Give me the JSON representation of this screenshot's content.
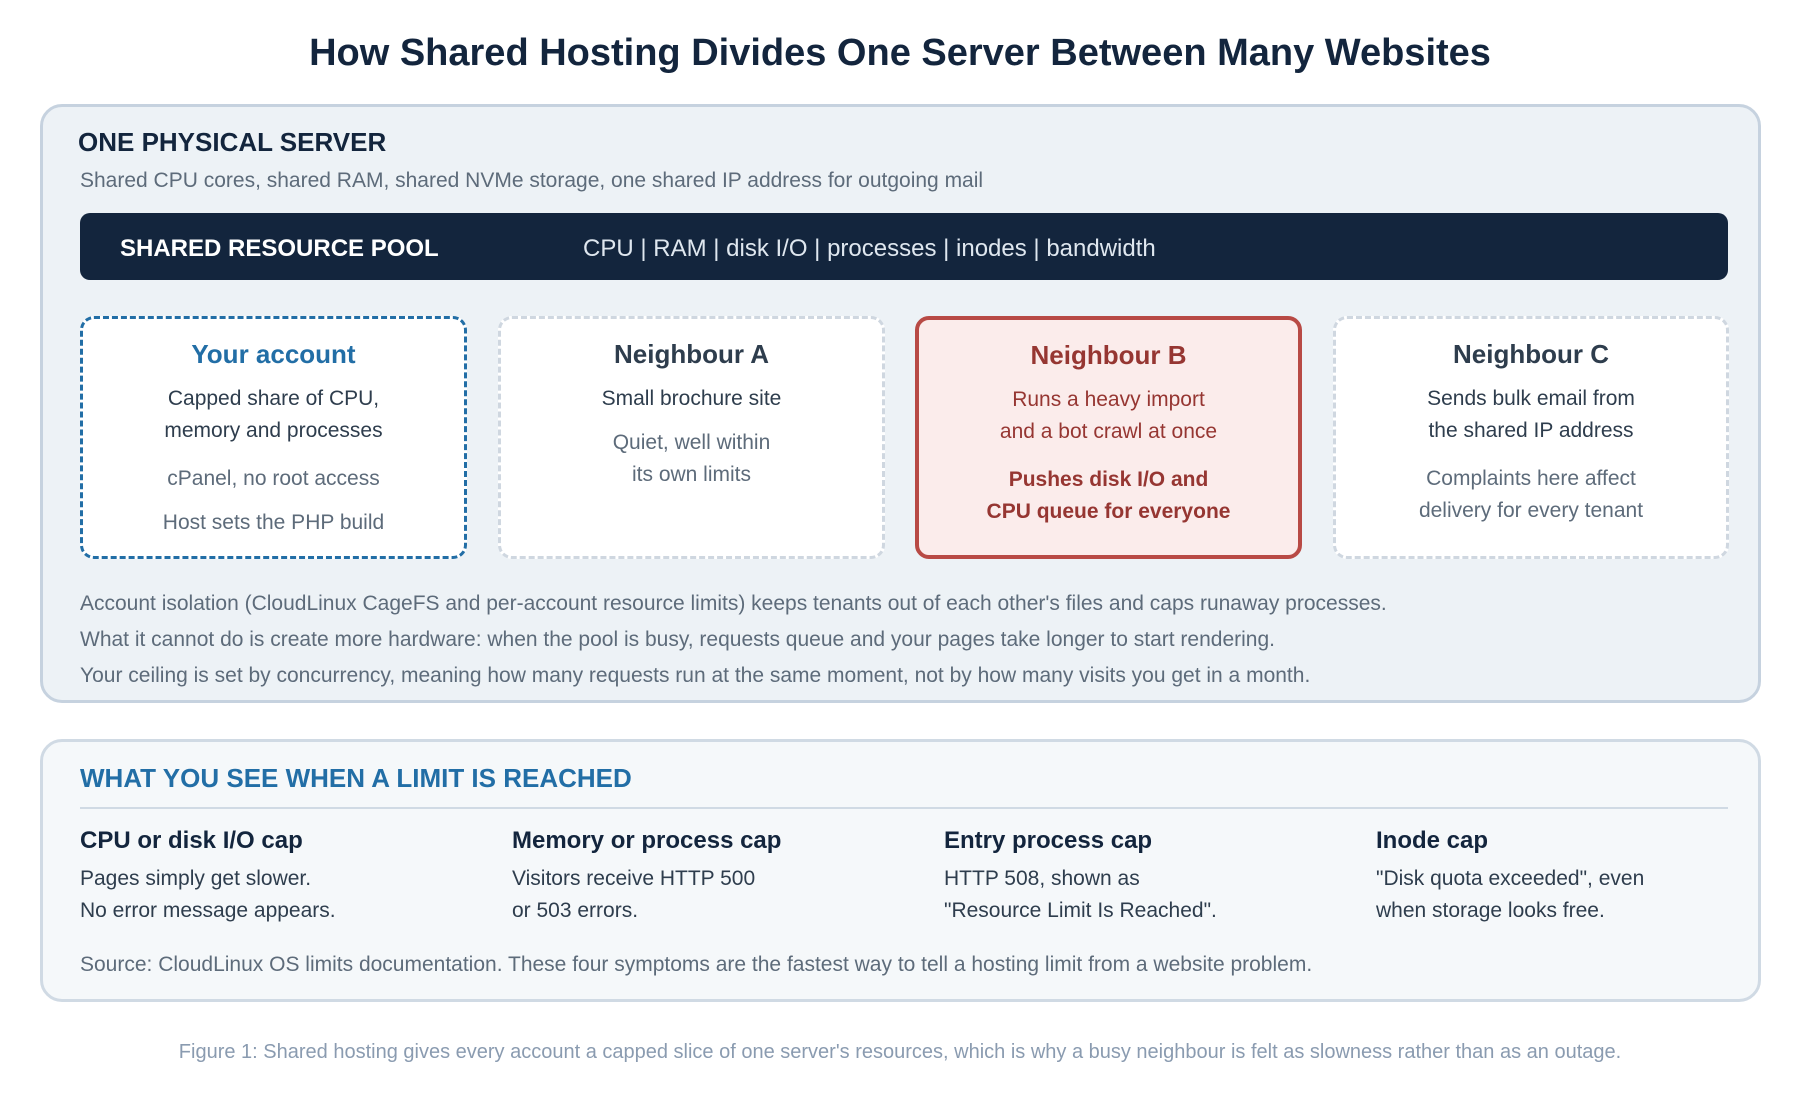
{
  "title": "How Shared Hosting Divides One Server Between Many Websites",
  "server": {
    "title": "ONE PHYSICAL SERVER",
    "subtitle": "Shared CPU cores, shared RAM, shared NVMe storage, one shared IP address for outgoing mail",
    "pool": {
      "label": "SHARED RESOURCE POOL",
      "items": "CPU | RAM | disk I/O | processes | inodes | bandwidth"
    },
    "cards": [
      {
        "title": "Your account",
        "lines": [
          "Capped share of CPU,",
          "memory and processes",
          "cPanel, no root access",
          "Host sets the PHP build"
        ]
      },
      {
        "title": "Neighbour A",
        "lines": [
          "Small brochure site",
          "Quiet, well within",
          "its own limits"
        ]
      },
      {
        "title": "Neighbour B",
        "lines": [
          "Runs a heavy import",
          "and a bot crawl at once",
          "Pushes disk I/O and",
          "CPU queue for everyone"
        ]
      },
      {
        "title": "Neighbour C",
        "lines": [
          "Sends bulk email from",
          "the shared IP address",
          "Complaints here affect",
          "delivery for every tenant"
        ]
      }
    ],
    "notes": [
      "Account isolation (CloudLinux CageFS and per-account resource limits) keeps tenants out of each other's files and caps runaway processes.",
      "What it cannot do is create more hardware: when the pool is busy, requests queue and your pages take longer to start rendering.",
      "Your ceiling is set by concurrency, meaning how many requests run at the same moment, not by how many visits you get in a month."
    ]
  },
  "limits": {
    "title": "WHAT YOU SEE WHEN A LIMIT IS REACHED",
    "items": [
      {
        "title": "CPU or disk I/O cap",
        "lines": [
          "Pages simply get slower.",
          "No error message appears."
        ]
      },
      {
        "title": "Memory or process cap",
        "lines": [
          "Visitors receive HTTP 500",
          "or 503 errors."
        ]
      },
      {
        "title": "Entry process cap",
        "lines": [
          "HTTP 508, shown as",
          "\"Resource Limit Is Reached\"."
        ]
      },
      {
        "title": "Inode cap",
        "lines": [
          "\"Disk quota exceeded\", even",
          "when storage looks free."
        ]
      }
    ],
    "source": "Source: CloudLinux OS limits documentation. These four symptoms are the fastest way to tell a hosting limit from a website problem."
  },
  "caption": "Figure 1: Shared hosting gives every account a capped slice of one server's resources, which is why a busy neighbour is felt as slowness rather than as an outage."
}
